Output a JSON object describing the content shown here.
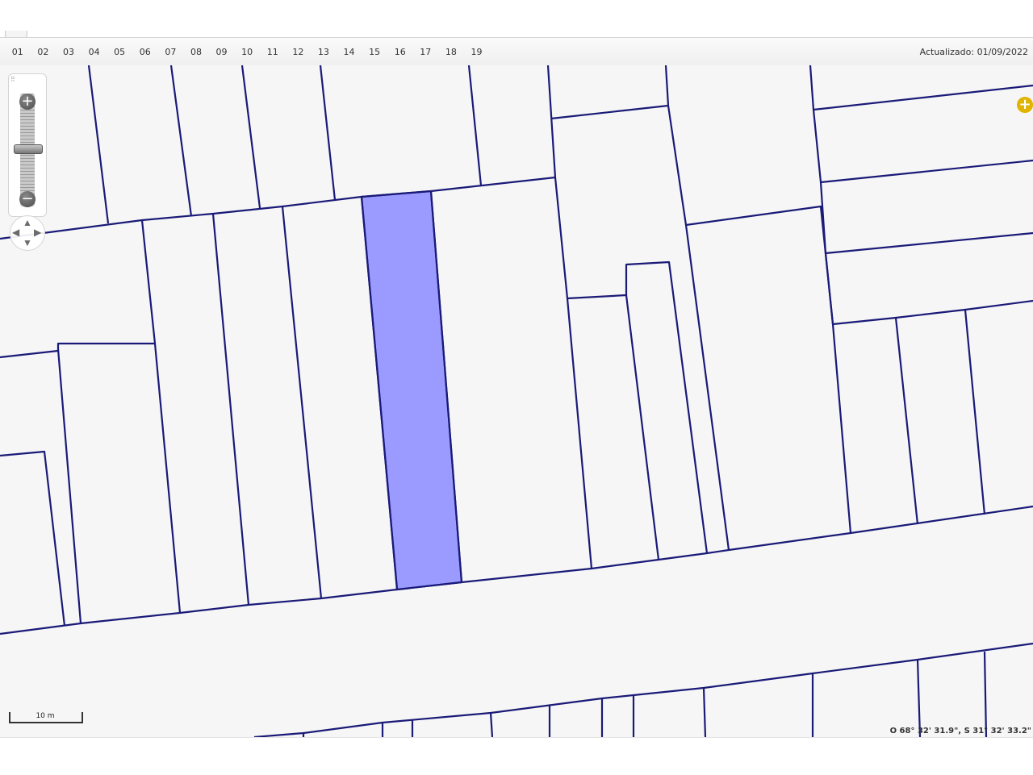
{
  "toolbar": {
    "pages": [
      "01",
      "02",
      "03",
      "04",
      "05",
      "06",
      "07",
      "08",
      "09",
      "10",
      "11",
      "12",
      "13",
      "14",
      "15",
      "16",
      "17",
      "18",
      "19"
    ],
    "updated_text": "Actualizado: 01/09/2022"
  },
  "map": {
    "parcel_color": "#f6f6f6",
    "selected_color": "#9a9aff",
    "line_color": "#1a1a78",
    "badge_color": "#e0b400"
  },
  "controls": {
    "zoom_in_symbol": "+",
    "zoom_out_symbol": "−",
    "pan_arrows": [
      "▲",
      "▼",
      "◀",
      "▶"
    ],
    "plus_symbol": "+",
    "grip_symbol": "⠿"
  },
  "scalebar": {
    "label": "10 m"
  },
  "coords": {
    "text": "O 68° 32' 31.9\", S 31° 32' 33.2\""
  }
}
